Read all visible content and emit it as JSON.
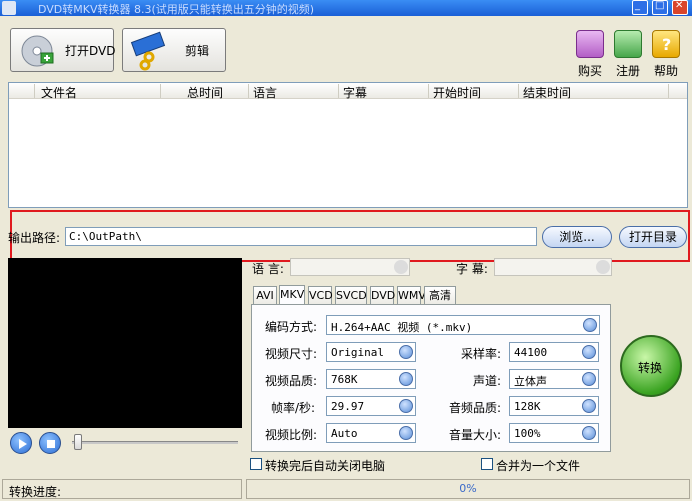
{
  "window": {
    "title": "DVD转MKV转换器 8.3(试用版只能转换出五分钟的视频)",
    "controls": [
      "minimize",
      "maximize",
      "close"
    ]
  },
  "toolbar": {
    "open_dvd_label": "打开DVD",
    "edit_label": "剪辑",
    "buy_label": "购买",
    "register_label": "注册",
    "help_label": "帮助"
  },
  "filelist": {
    "columns": [
      "文件名",
      "总时间",
      "语言",
      "字幕",
      "开始时间",
      "结束时间"
    ],
    "rows": []
  },
  "output": {
    "label": "输出路径:",
    "path": "C:\\OutPath\\",
    "browse_label": "浏览...",
    "open_dir_label": "打开目录"
  },
  "audio_sub": {
    "audio_label": "语 言:",
    "subtitle_label": "字 幕:"
  },
  "format_tabs": [
    "AVI",
    "MKV",
    "VCD",
    "SVCD",
    "DVD",
    "WMV",
    "高清"
  ],
  "active_tab": "MKV",
  "settings": {
    "encode_label": "编码方式:",
    "encode_value": "H.264+AAC 视频 (*.mkv)",
    "size_label": "视频尺寸:",
    "size_value": "Original",
    "quality_label": "视频品质:",
    "quality_value": "768K",
    "fps_label": "帧率/秒:",
    "fps_value": "29.97",
    "aspect_label": "视频比例:",
    "aspect_value": "Auto",
    "samplerate_label": "采样率:",
    "samplerate_value": "44100",
    "channel_label": "声道:",
    "channel_value": "立体声",
    "audio_quality_label": "音频品质:",
    "audio_quality_value": "128K",
    "volume_label": "音量大小:",
    "volume_value": "100%"
  },
  "convert_label": "转换",
  "options": {
    "shutdown_label": "转换完后自动关闭电脑",
    "merge_label": "合并为一个文件"
  },
  "status": {
    "progress_label": "转换进度:",
    "progress_text": "0%",
    "progress_fraction": 0
  },
  "colors": {
    "highlight": "#e0191e",
    "titlebar": "#2a72e8",
    "accent_link": "#3a6ac9"
  }
}
